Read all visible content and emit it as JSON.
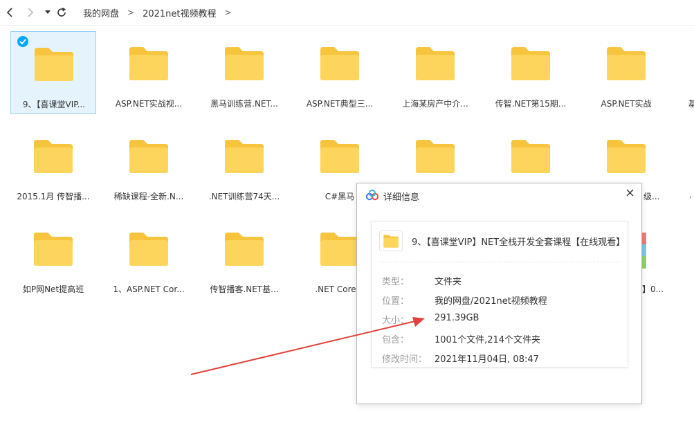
{
  "breadcrumb": {
    "root": "我的网盘",
    "sep1": ">",
    "current": "2021net视频教程",
    "sep2": ">"
  },
  "icons": {
    "back": "chevron-left-icon",
    "forward": "chevron-right-icon",
    "history": "caret-down-icon",
    "refresh": "refresh-icon"
  },
  "folders": [
    {
      "label": "9、【喜课堂VIP..."
    },
    {
      "label": "ASP.NET实战视..."
    },
    {
      "label": "黑马训练营.NET..."
    },
    {
      "label": "ASP.NET典型三..."
    },
    {
      "label": "上海某房产中介..."
    },
    {
      "label": "传智.NET第15期..."
    },
    {
      "label": "ASP.NET实战"
    },
    {
      "label": "2015.1月 传智播..."
    },
    {
      "label": "稀缺课程-全新.N..."
    },
    {
      "label": ".NET训练营74天..."
    },
    {
      "label": "C#黑马"
    },
    {
      "label": "如P网Net提高班"
    },
    {
      "label": "1、ASP.NET Cor..."
    },
    {
      "label": "传智播客.NET基..."
    },
    {
      "label": ".NET Core微"
    }
  ],
  "partial_labels": {
    "row1_edge": "基",
    "row2_right": "级...",
    "row2_edge": ".",
    "row3_right": "】0..."
  },
  "details": {
    "title": "详细信息",
    "folder_name": "9、【喜课堂VIP】NET全栈开发全套课程【在线观看】",
    "rows": [
      {
        "k": "类型：",
        "v": "文件夹"
      },
      {
        "k": "位置：",
        "v": "我的网盘/2021net视频教程"
      },
      {
        "k": "大小：",
        "v": "291.39GB"
      },
      {
        "k": "包含：",
        "v": "1001个文件,214个文件夹"
      },
      {
        "k": "修改时间：",
        "v": "2021年11月04日, 08:47"
      }
    ]
  },
  "colors": {
    "folder": "#fdd45c",
    "folder_tab": "#f7c43d",
    "select_bg": "#e5f3fc",
    "select_border": "#99d1f5",
    "check": "#06a7ff",
    "arrow": "#e0423c"
  }
}
